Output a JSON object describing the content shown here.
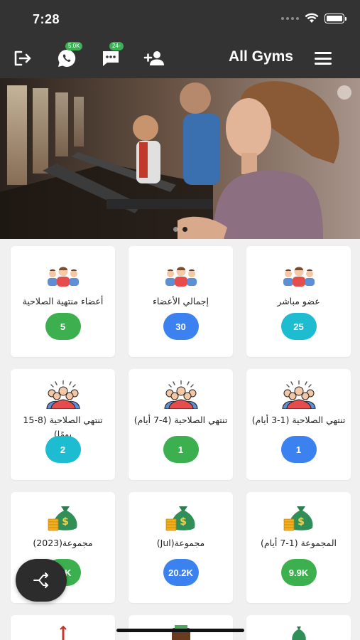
{
  "status_bar": {
    "time": "7:28"
  },
  "header": {
    "title": "All Gyms",
    "whatsapp_badge": "5.0K",
    "messages_badge": "24-",
    "icons": [
      "logout-icon",
      "whatsapp-icon",
      "messages-icon",
      "add-user-icon",
      "menu-icon"
    ]
  },
  "banner": {
    "slides": 2,
    "active_slide": 2
  },
  "cards": [
    {
      "label": "عضو مباشر",
      "count": "25",
      "color": "#1ebcd0",
      "icon": "members-group-icon"
    },
    {
      "label": "إجمالي الأعضاء",
      "count": "30",
      "color": "#3b82f0",
      "icon": "members-group-icon"
    },
    {
      "label": "أعضاء منتهية الصلاحية",
      "count": "5",
      "color": "#3cb04e",
      "icon": "members-group-icon"
    },
    {
      "label": "تنتهي الصلاحية (1-3 أيام)",
      "count": "1",
      "color": "#3b82f0",
      "icon": "crowd-icon"
    },
    {
      "label": "تنتهي الصلاحية (4-7 أيام)",
      "count": "1",
      "color": "#3cb04e",
      "icon": "crowd-icon"
    },
    {
      "label": "تنتهي الصلاحية (8-15 يومًا)",
      "count": "2",
      "color": "#1ebcd0",
      "icon": "crowd-icon"
    },
    {
      "label": "المجموعة (1-7 أيام)",
      "count": "9.9K",
      "color": "#3cb04e",
      "icon": "money-bag-icon"
    },
    {
      "label": "مجموعة(Jul)",
      "count": "20.2K",
      "color": "#3b82f0",
      "icon": "money-bag-icon"
    },
    {
      "label": "مجموعة(2023)",
      "count": "38K",
      "color": "#3cb04e",
      "icon": "money-bag-icon"
    }
  ],
  "fab": {
    "icon": "share-icon"
  }
}
